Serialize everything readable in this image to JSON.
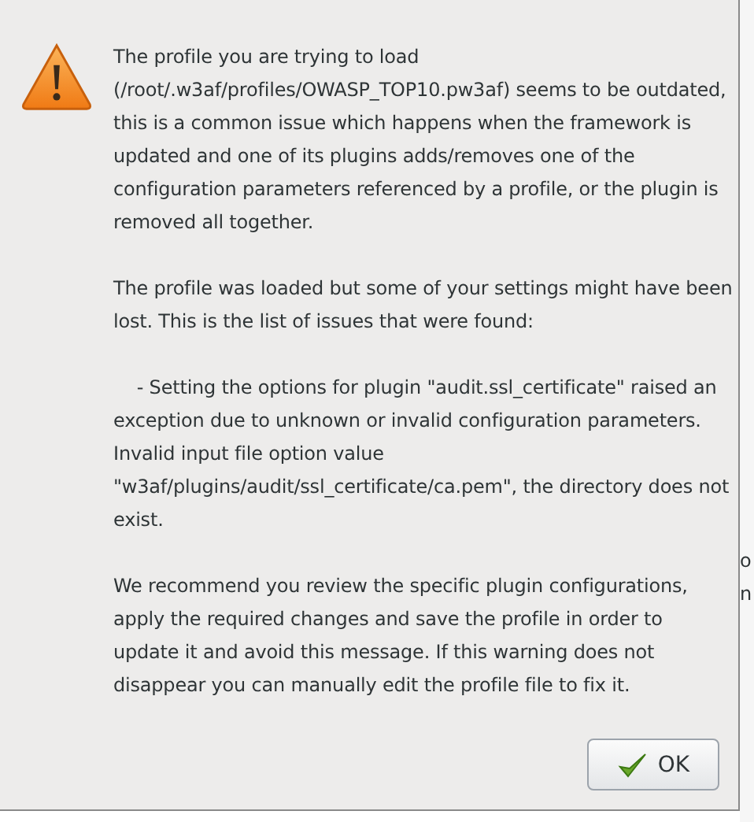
{
  "dialog": {
    "kind": "warning",
    "paragraphs": [
      "The profile you are trying to load (/root/.w3af/profiles/OWASP_TOP10.pw3af) seems to be outdated, this is a common issue which happens when the framework is updated and one of its plugins adds/removes one of the configuration parameters referenced by a profile, or the plugin is removed all together.",
      "The profile was loaded but some of your settings might have been lost. This is the list of issues that were found:",
      "    - Setting the options for plugin \"audit.ssl_certificate\" raised an exception due to unknown or invalid configuration parameters. Invalid input file option value \"w3af/plugins/audit/ssl_certificate/ca.pem\", the directory does not exist.",
      "We recommend you review the specific plugin configurations, apply the required changes and save the profile in order to update it and avoid this message. If this warning does not disappear you can manually edit the profile file to fix it."
    ],
    "buttons": [
      "OK"
    ]
  },
  "background_window": {
    "fragments": [
      "o",
      "n"
    ]
  }
}
